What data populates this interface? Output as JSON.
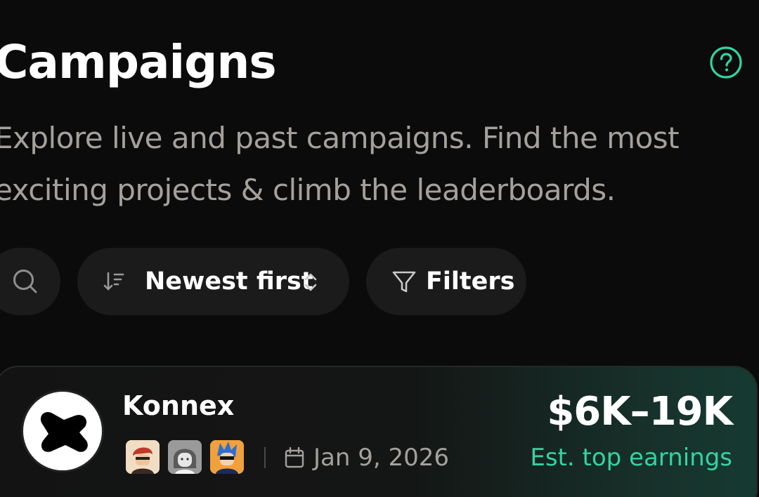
{
  "header": {
    "title": "Campaigns",
    "subtitle": "Explore live and past campaigns. Find the most exciting projects & climb the leaderboards."
  },
  "toolbar": {
    "sort_label": "Newest first",
    "filters_label": "Filters"
  },
  "campaign": {
    "name": "Konnex",
    "date": "Jan 9, 2026",
    "amount": "$6K–19K",
    "amount_caption": "Est. top earnings"
  },
  "colors": {
    "background": "#0b0b0b",
    "accent": "#34d3a1",
    "pill": "#1b1b1b",
    "muted_text": "#a4a19d"
  },
  "icons": {
    "help": "help-circle-icon",
    "search": "search-icon",
    "sort": "sort-descending-icon",
    "chevron": "chevron-up-down-icon",
    "filter": "filter-funnel-icon",
    "calendar": "calendar-icon"
  }
}
